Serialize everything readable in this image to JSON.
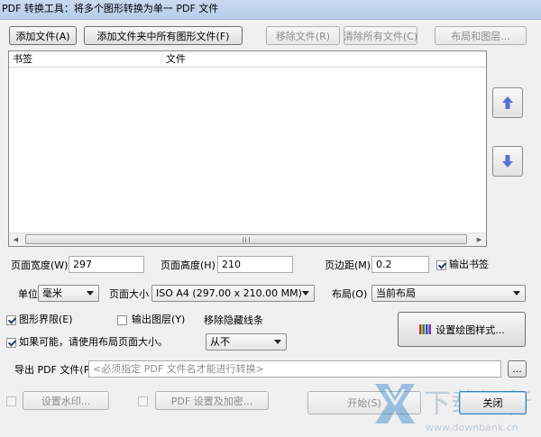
{
  "window": {
    "title": "PDF 转换工具：将多个图形转换为单一 PDF 文件"
  },
  "toolbar": {
    "add_file": "添加文件(A)",
    "add_folder": "添加文件夹中所有图形文件(F)",
    "remove_file": "移除文件(R)",
    "clear_all": "清除所有文件(C)",
    "layout_layers": "布局和图层..."
  },
  "list": {
    "columns": [
      "书签",
      "文件"
    ]
  },
  "page": {
    "width_label": "页面宽度(W)",
    "width_value": "297",
    "height_label": "页面高度(H)",
    "height_value": "210",
    "margin_label": "页边距(M)",
    "margin_value": "0.2",
    "output_bookmarks": "输出书签",
    "unit_label": "单位",
    "unit_value": "毫米",
    "size_label": "页面大小",
    "size_value": "ISO A4 (297.00 x 210.00 MM)",
    "layout_label": "布局(O)",
    "layout_value": "当前布局"
  },
  "options": {
    "extents": "图形界限(E)",
    "output_layers": "输出图层(Y)",
    "hidden_lines_label": "移除隐藏线条",
    "hidden_lines_value": "从不",
    "use_layout_size": "如果可能，请使用布局页面大小。",
    "plot_style_button": "设置绘图样式..."
  },
  "export": {
    "label": "导出 PDF 文件(P)",
    "placeholder": "<必须指定 PDF 文件名才能进行转换>",
    "browse": "..."
  },
  "bottom": {
    "watermark": "设置水印...",
    "pdf_settings": "PDF 设置及加密...",
    "start": "开始(S)",
    "close": "关闭"
  },
  "brand": {
    "name": "下载银行",
    "url": "www.downbank.cn"
  },
  "colors": {
    "accent_arrow": "#5b6fd6",
    "title_bar": "#c3d5ee"
  }
}
